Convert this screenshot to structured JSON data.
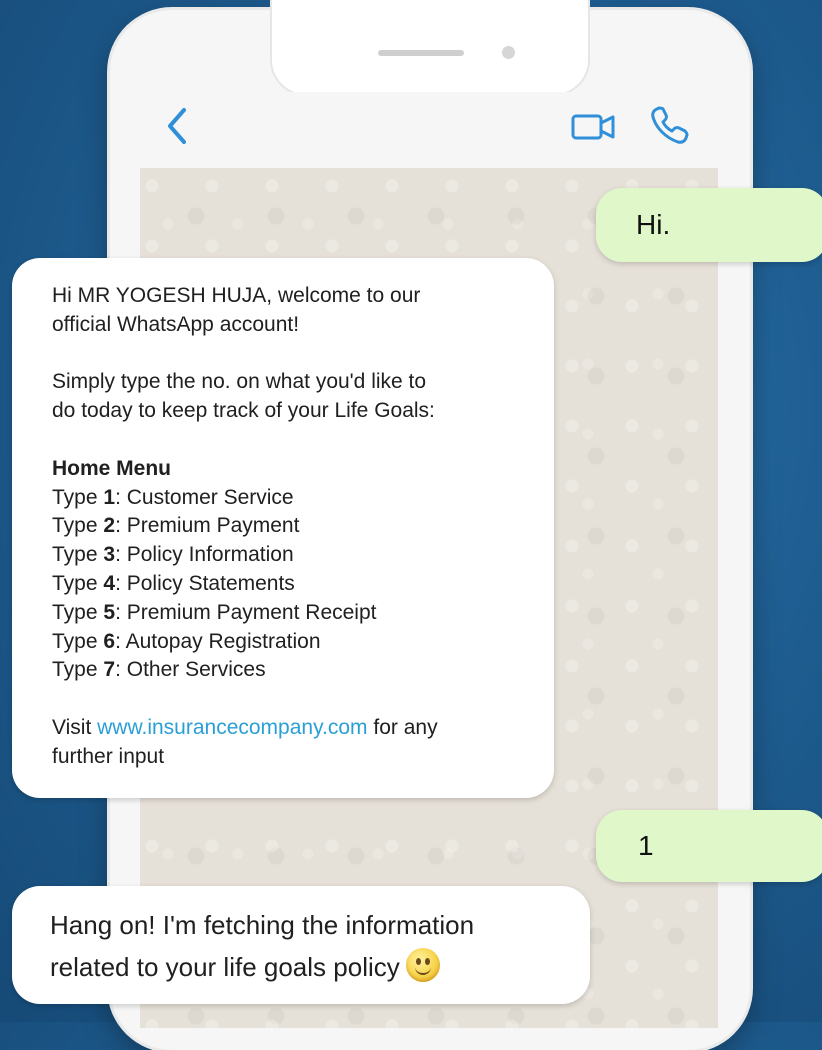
{
  "header": {
    "back_icon": "chevron-left-icon",
    "video_icon": "video-camera-icon",
    "call_icon": "phone-icon",
    "accent_color": "#2f8fd8"
  },
  "messages": {
    "outgoing_1": "Hi.",
    "welcome": {
      "line1": "Hi MR YOGESH  HUJA, welcome to our",
      "line2": "official WhatsApp account!",
      "line3": "Simply type the no. on what you'd like to",
      "line4": "do today to keep track of your Life Goals:",
      "menu_title": "Home Menu",
      "menu_items": [
        {
          "prefix": "Type ",
          "number": "1",
          "label": ": Customer Service"
        },
        {
          "prefix": "Type ",
          "number": "2",
          "label": ": Premium Payment"
        },
        {
          "prefix": "Type ",
          "number": "3",
          "label": ": Policy Information"
        },
        {
          "prefix": "Type ",
          "number": "4",
          "label": ": Policy Statements"
        },
        {
          "prefix": "Type ",
          "number": "5",
          "label": ": Premium Payment Receipt"
        },
        {
          "prefix": "Type ",
          "number": "6",
          "label": ": Autopay Registration"
        },
        {
          "prefix": "Type ",
          "number": "7",
          "label": ": Other Services"
        }
      ],
      "visit_prefix": "Visit ",
      "visit_link": "www.insurancecompany.com",
      "visit_suffix": " for any",
      "visit_line2": "further input"
    },
    "outgoing_2": "1",
    "fetch_line1": "Hang on! I'm fetching the information",
    "fetch_line2": "related to your life goals policy",
    "fetch_emoji": "smiling-face-icon"
  },
  "colors": {
    "background": "#1f5f93",
    "outgoing_bubble": "#dff7c9",
    "incoming_bubble": "#ffffff",
    "chat_background": "#e6e1d8",
    "link": "#2a9fd6"
  }
}
